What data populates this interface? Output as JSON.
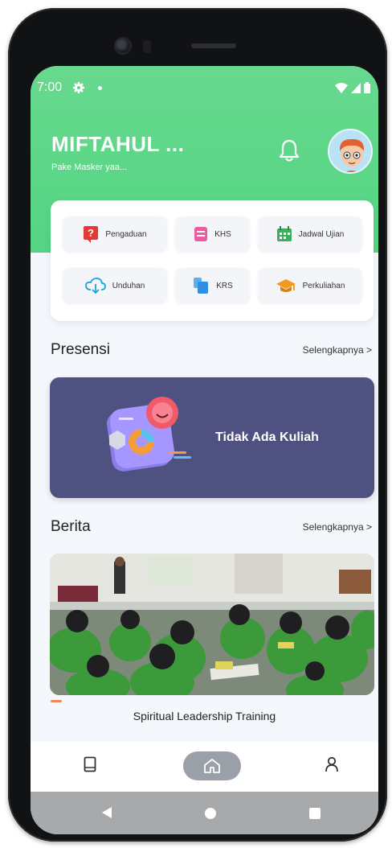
{
  "status_bar": {
    "time": "7:00"
  },
  "header": {
    "user_name": "MIFTAHUL ...",
    "greeting": "Pake Masker yaa..."
  },
  "menu": {
    "items": [
      {
        "label": "Pengaduan",
        "icon": "question-icon",
        "color": "#e53935"
      },
      {
        "label": "KHS",
        "icon": "document-icon",
        "color": "#ec5ca0"
      },
      {
        "label": "Jadwal Ujian",
        "icon": "calendar-icon",
        "color": "#3fae5a"
      },
      {
        "label": "Unduhan",
        "icon": "cloud-download-icon",
        "color": "#1aa3d9"
      },
      {
        "label": "KRS",
        "icon": "files-icon",
        "color": "#2f8fe0"
      },
      {
        "label": "Perkuliahan",
        "icon": "graduation-cap-icon",
        "color": "#f39a1e"
      }
    ]
  },
  "presensi": {
    "title": "Presensi",
    "more_label": "Selengkapnya >",
    "status_text": "Tidak Ada Kuliah"
  },
  "berita": {
    "title": "Berita",
    "more_label": "Selengkapnya >",
    "caption": "Spiritual Leadership Training"
  },
  "colors": {
    "header_green": "#5dd688",
    "presensi_card": "#4f5180",
    "accent_orange": "#f0885b"
  }
}
